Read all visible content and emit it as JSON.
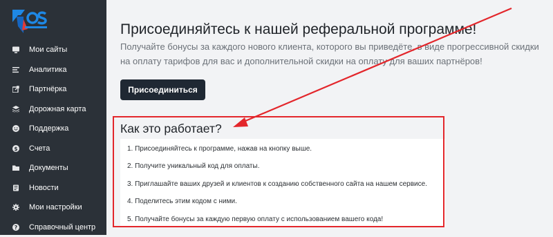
{
  "sidebar": {
    "logo_icon": "company-logo",
    "items": [
      {
        "label": "Мои сайты",
        "icon": "monitor-icon"
      },
      {
        "label": "Аналитика",
        "icon": "bars-icon"
      },
      {
        "label": "Партнёрка",
        "icon": "share-icon"
      },
      {
        "label": "Дорожная карта",
        "icon": "layers-icon"
      },
      {
        "label": "Поддержка",
        "icon": "smile-icon"
      },
      {
        "label": "Счета",
        "icon": "dollar-icon"
      },
      {
        "label": "Документы",
        "icon": "folder-icon"
      },
      {
        "label": "Новости",
        "icon": "newspaper-icon"
      },
      {
        "label": "Мои настройки",
        "icon": "gear-icon"
      },
      {
        "label": "Справочный центр",
        "icon": "help-icon"
      }
    ]
  },
  "main": {
    "title": "Присоединяйтесь к нашей реферальной программе!",
    "subtitle": "Получайте бонусы за каждого нового клиента, которого вы приведёте, в виде прогрессивной скидки на оплату тарифов для вас и дополнительной скидки на оплату для ваших партнёров!",
    "join_button": "Присоединиться",
    "how_title": "Как это работает?",
    "steps": [
      "1. Присоединяйтесь к программе, нажав на кнопку выше.",
      "2. Получите уникальный код для оплаты.",
      "3. Приглашайте ваших друзей и клиентов к созданию собственного сайта на нашем сервисе.",
      "4. Поделитесь этим кодом с ними.",
      "5. Получайте бонусы за каждую первую оплату с использованием вашего кода!"
    ]
  },
  "colors": {
    "sidebar_bg": "#2b3138",
    "accent_blue": "#1e88e5",
    "button_bg": "#1f2833",
    "annotation_red": "#e3262b"
  }
}
